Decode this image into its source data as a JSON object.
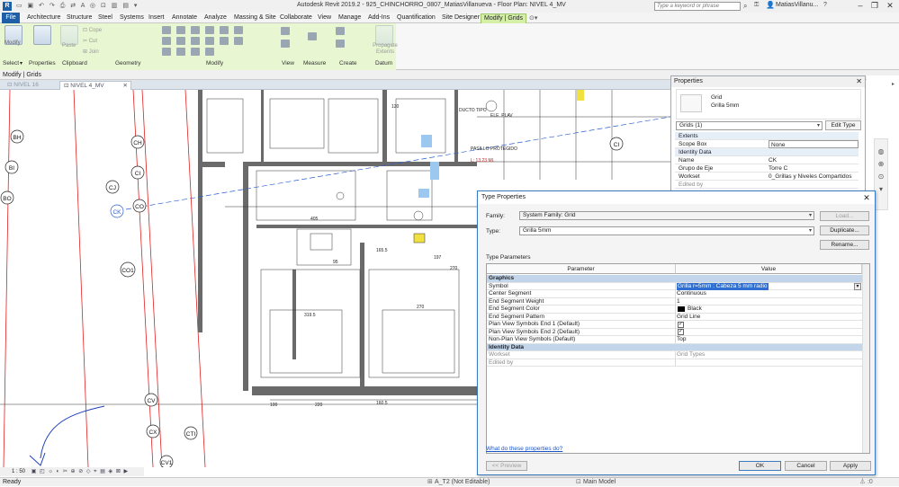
{
  "title_bar": {
    "title": "Autodesk Revit 2019.2 - 925_CHINCHORRO_0807_MatiasVillanueva - Floor Plan: NIVEL 4_MV",
    "search_placeholder": "Type a keyword or phrase",
    "user": "MatiasVillanu..."
  },
  "ribbon": {
    "tabs": [
      "File",
      "Architecture",
      "Structure",
      "Steel",
      "Systems",
      "Insert",
      "Annotate",
      "Analyze",
      "Massing & Site",
      "Collaborate",
      "View",
      "Manage",
      "Add-Ins",
      "Quantification",
      "Site Designer",
      "Modify | Grids"
    ],
    "panels": {
      "modify_label": "Modify",
      "select": "Select",
      "properties": "Properties",
      "clipboard": "Clipboard",
      "geometry": "Geometry",
      "modify": "Modify",
      "view": "View",
      "measure": "Measure",
      "create": "Create",
      "datum": "Datum",
      "paste": "Paste",
      "cope": "Cope",
      "cut": "Cut",
      "join": "Join",
      "propagate": "Propagate Extents"
    }
  },
  "modify_bar": "Modify | Grids",
  "view_tabs": [
    "NIVEL 16",
    "NIVEL 4_MV"
  ],
  "drawing": {
    "grid_bubbles": [
      "BH",
      "BI",
      "BO",
      "CH",
      "CI",
      "CJ",
      "CK",
      "CO",
      "CO1",
      "CV",
      "CX",
      "CTI",
      "CV1",
      "CI"
    ],
    "room_labels": [
      "PASILLO PROTEGIDO",
      "L: 13.23 ML",
      "DUCTO TIPO",
      "ELE. PLAV"
    ],
    "dimensions": [
      "405",
      "165.5",
      "197",
      "220",
      "160.5",
      "270",
      "270",
      "319.5",
      "100",
      "95",
      "120"
    ]
  },
  "status": {
    "scale": "1 : 50",
    "ready": "Ready",
    "design_option": "A_T2 (Not Editable)",
    "model": "Main Model"
  },
  "properties_palette": {
    "header": "Properties",
    "family": "Grid",
    "type": "Grilla 5mm",
    "selector": "Grids (1)",
    "edit_type": "Edit Type",
    "rows": [
      {
        "category": true,
        "key": "Extents",
        "value": ""
      },
      {
        "key": "Scope Box",
        "value": "None"
      },
      {
        "category": true,
        "key": "Identity Data",
        "value": ""
      },
      {
        "key": "Name",
        "value": "CK"
      },
      {
        "key": "Grupo de Eje",
        "value": "Torre C"
      },
      {
        "key": "Workset",
        "value": "0_Grillas y Niveles Compartidos"
      },
      {
        "key": "Edited by",
        "value": ""
      }
    ]
  },
  "type_dialog": {
    "title": "Type Properties",
    "family_label": "Family:",
    "family_value": "System Family: Grid",
    "type_label": "Type:",
    "type_value": "Grilla 5mm",
    "load": "Load...",
    "duplicate": "Duplicate...",
    "rename": "Rename...",
    "type_parameters": "Type Parameters",
    "col_parameter": "Parameter",
    "col_value": "Value",
    "rows": [
      {
        "kind": "cat",
        "key": "Graphics",
        "value": ""
      },
      {
        "kind": "sel",
        "key": "Symbol",
        "value": "Grilla r=5mm : Cabeza 5 mm radio"
      },
      {
        "kind": "text",
        "key": "Center Segment",
        "value": "Continuous"
      },
      {
        "kind": "text",
        "key": "End Segment Weight",
        "value": "1"
      },
      {
        "kind": "color",
        "key": "End Segment Color",
        "value": "Black"
      },
      {
        "kind": "text",
        "key": "End Segment Pattern",
        "value": "Grid Line"
      },
      {
        "kind": "check",
        "key": "Plan View Symbols End 1 (Default)",
        "value": "✓"
      },
      {
        "kind": "check",
        "key": "Plan View Symbols End 2 (Default)",
        "value": "✓"
      },
      {
        "kind": "text",
        "key": "Non-Plan View Symbols (Default)",
        "value": "Top"
      },
      {
        "kind": "cat",
        "key": "Identity Data",
        "value": ""
      },
      {
        "kind": "gray",
        "key": "Workset",
        "value": "Grid Types"
      },
      {
        "kind": "gray",
        "key": "Edited by",
        "value": ""
      }
    ],
    "help_link": "What do these properties do?",
    "preview": "<< Preview",
    "ok": "OK",
    "cancel": "Cancel",
    "apply": "Apply"
  }
}
